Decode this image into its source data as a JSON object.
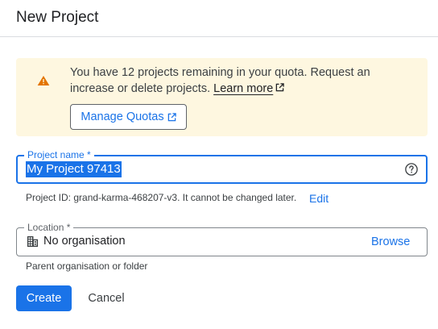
{
  "dialog": {
    "title": "New Project"
  },
  "quota_banner": {
    "icon": "warning-icon",
    "warning_color": "#e37400",
    "background_color": "#fef7e0",
    "message": "You have 12 projects remaining in your quota. Request an increase or delete projects.",
    "learn_more_label": "Learn more",
    "manage_quotas_label": "Manage Quotas",
    "external_link_icon": "external-link-icon"
  },
  "project_name": {
    "label": "Project name *",
    "value": "My Project 97413",
    "text_selected": true,
    "help_icon": "help-circle-icon"
  },
  "project_id": {
    "prefix": "Project ID: ",
    "id": "grand-karma-468207-v3",
    "suffix": ". It cannot be changed later.",
    "edit_label": "Edit"
  },
  "location": {
    "label": "Location *",
    "icon": "organisation-building-icon",
    "value": "No organisation",
    "browse_label": "Browse",
    "helper": "Parent organisation or folder"
  },
  "actions": {
    "create_label": "Create",
    "cancel_label": "Cancel"
  },
  "colors": {
    "accent": "#1a73e8",
    "text": "#202124",
    "secondary_text": "#3c4043"
  }
}
